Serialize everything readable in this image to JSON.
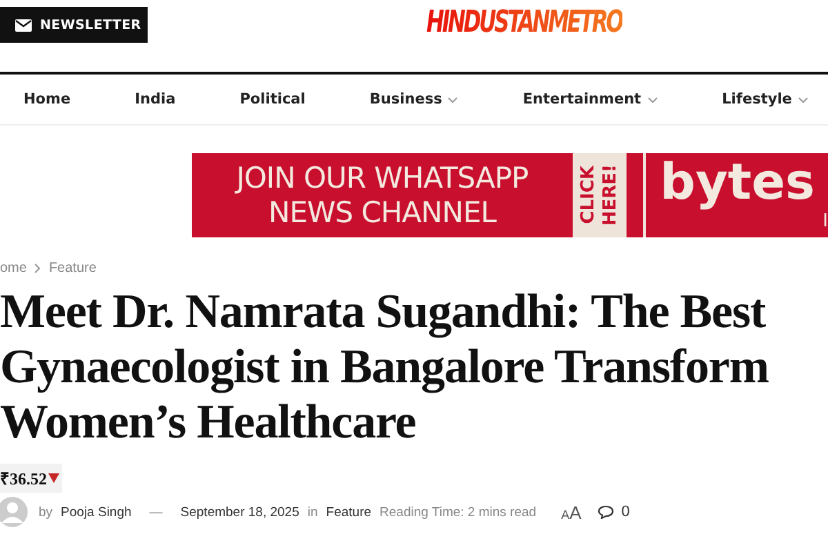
{
  "header": {
    "newsletter_button": "NEWSLETTER",
    "logo": "HINDUSTANMETRO"
  },
  "nav": [
    {
      "label": "Home",
      "dropdown": false
    },
    {
      "label": "India",
      "dropdown": false
    },
    {
      "label": "Political",
      "dropdown": false
    },
    {
      "label": "Business",
      "dropdown": true
    },
    {
      "label": "Entertainment",
      "dropdown": true
    },
    {
      "label": "Lifestyle",
      "dropdown": true
    }
  ],
  "ad": {
    "headline": [
      "JOIN OUR WHATSAPP",
      "NEWS CHANNEL"
    ],
    "cta": [
      "CLICK",
      "HERE!"
    ],
    "brand": "bytes",
    "brand_sub": "I"
  },
  "breadcrumb": [
    "ome",
    "Feature"
  ],
  "article": {
    "title": [
      "Meet Dr. Namrata Sugandhi: The Best",
      "Gynaecologist in Bangalore Transform",
      "Women’s Healthcare"
    ],
    "ticker": {
      "price": "₹36.52",
      "falling": true
    },
    "meta": {
      "by": "by",
      "author": "Pooja Singh",
      "separator": "—",
      "date": "September 18, 2025",
      "in": "in",
      "category": "Feature",
      "reading_time": "Reading Time: 2 mins read",
      "font_small": "A",
      "font_large": "A",
      "comments": "0"
    }
  }
}
